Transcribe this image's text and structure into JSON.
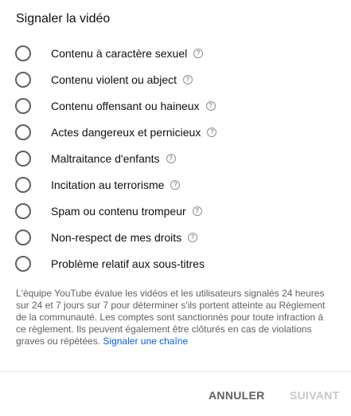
{
  "dialog": {
    "title": "Signaler la vidéo"
  },
  "options": [
    {
      "label": "Contenu à caractère sexuel",
      "help": true
    },
    {
      "label": "Contenu violent ou abject",
      "help": true
    },
    {
      "label": "Contenu offensant ou haineux",
      "help": true
    },
    {
      "label": "Actes dangereux et pernicieux",
      "help": true
    },
    {
      "label": "Maltraitance d'enfants",
      "help": true
    },
    {
      "label": "Incitation au terrorisme",
      "help": true
    },
    {
      "label": "Spam ou contenu trompeur",
      "help": true
    },
    {
      "label": "Non-respect de mes droits",
      "help": true
    },
    {
      "label": "Problème relatif aux sous-titres",
      "help": false
    }
  ],
  "notice": {
    "text": "L'équipe YouTube évalue les vidéos et les utilisateurs signalés 24 heures sur 24 et 7 jours sur 7 pour déterminer s'ils portent atteinte au Règlement de la communauté. Les comptes sont sanctionnés pour toute infraction à ce règlement. Ils peuvent également être clôturés en cas de violations graves ou répétées.",
    "link_label": "Signaler une chaîne"
  },
  "footer": {
    "cancel_label": "ANNULER",
    "next_label": "SUIVANT"
  },
  "colors": {
    "link": "#065fd4",
    "secondary_text": "#606060",
    "disabled_text": "#c8c8c8"
  }
}
